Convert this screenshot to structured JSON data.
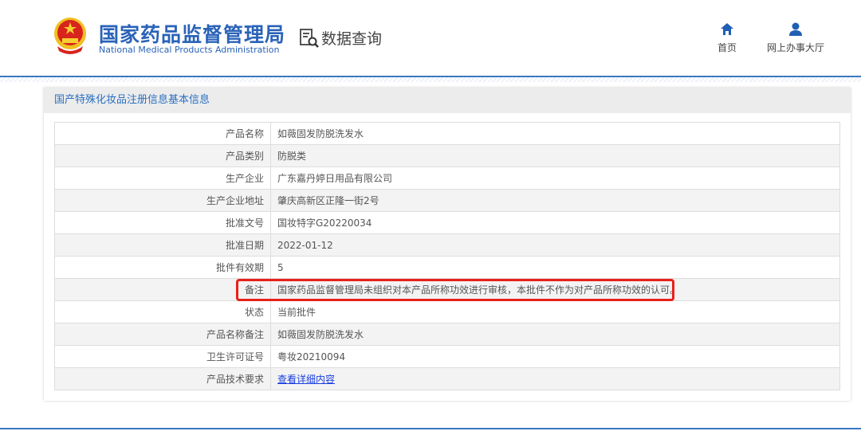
{
  "header": {
    "logo_cn": "国家药品监督管理局",
    "logo_en": "National Medical Products Administration",
    "query_label": "数据查询",
    "nav": [
      {
        "label": "首页",
        "icon": "home-icon"
      },
      {
        "label": "网上办事大厅",
        "icon": "user-icon"
      }
    ]
  },
  "panel": {
    "title": "国产特殊化妆品注册信息基本信息",
    "rows": [
      {
        "label": "产品名称",
        "value": "如薇固发防脱洗发水"
      },
      {
        "label": "产品类别",
        "value": "防脱类"
      },
      {
        "label": "生产企业",
        "value": "广东嘉丹婷日用品有限公司"
      },
      {
        "label": "生产企业地址",
        "value": "肇庆高新区正隆一街2号"
      },
      {
        "label": "批准文号",
        "value": "国妆特字G20220034"
      },
      {
        "label": "批准日期",
        "value": "2022-01-12"
      },
      {
        "label": "批件有效期",
        "value": "5"
      },
      {
        "label": "备注",
        "value": "国家药品监督管理局未组织对本产品所称功效进行审核，本批件不作为对产品所称功效的认可。"
      },
      {
        "label": "状态",
        "value": "当前批件"
      },
      {
        "label": "产品名称备注",
        "value": "如薇固发防脱洗发水"
      },
      {
        "label": "卫生许可证号",
        "value": "粤妆20210094"
      },
      {
        "label": "产品技术要求",
        "value": "查看详细内容"
      }
    ]
  },
  "colors": {
    "accent": "#2a63b8",
    "highlight": "#e8211a"
  }
}
